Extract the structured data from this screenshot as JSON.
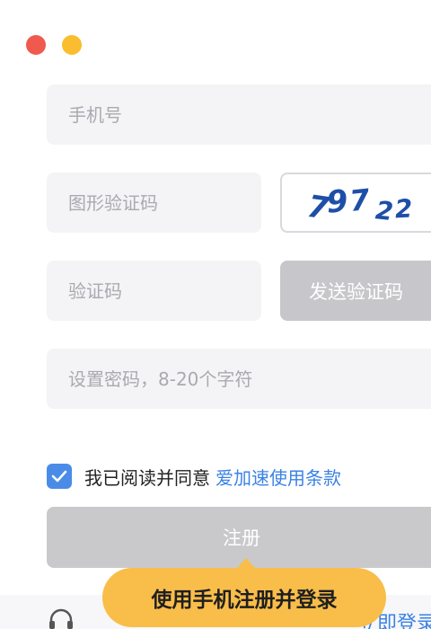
{
  "window": {
    "controls": [
      "close",
      "minimize"
    ]
  },
  "form": {
    "phone_placeholder": "手机号",
    "captcha_placeholder": "图形验证码",
    "captcha_text": "79722",
    "code_placeholder": "验证码",
    "send_code_label": "发送验证码",
    "password_placeholder": "设置密码，8-20个字符",
    "agree_text": "我已阅读并同意",
    "terms_link": "爱加速使用条款",
    "agree_checked": true,
    "register_label": "注册"
  },
  "footer": {
    "login_link": "立即登录",
    "headset_icon": "headset-icon"
  },
  "tooltip": {
    "text": "使用手机注册并登录"
  },
  "colors": {
    "accent": "#3b82e6",
    "checkbox": "#4a8be8",
    "tooltip": "#f9bd4a",
    "close": "#f05a4e",
    "minimize": "#f9bd2f"
  }
}
